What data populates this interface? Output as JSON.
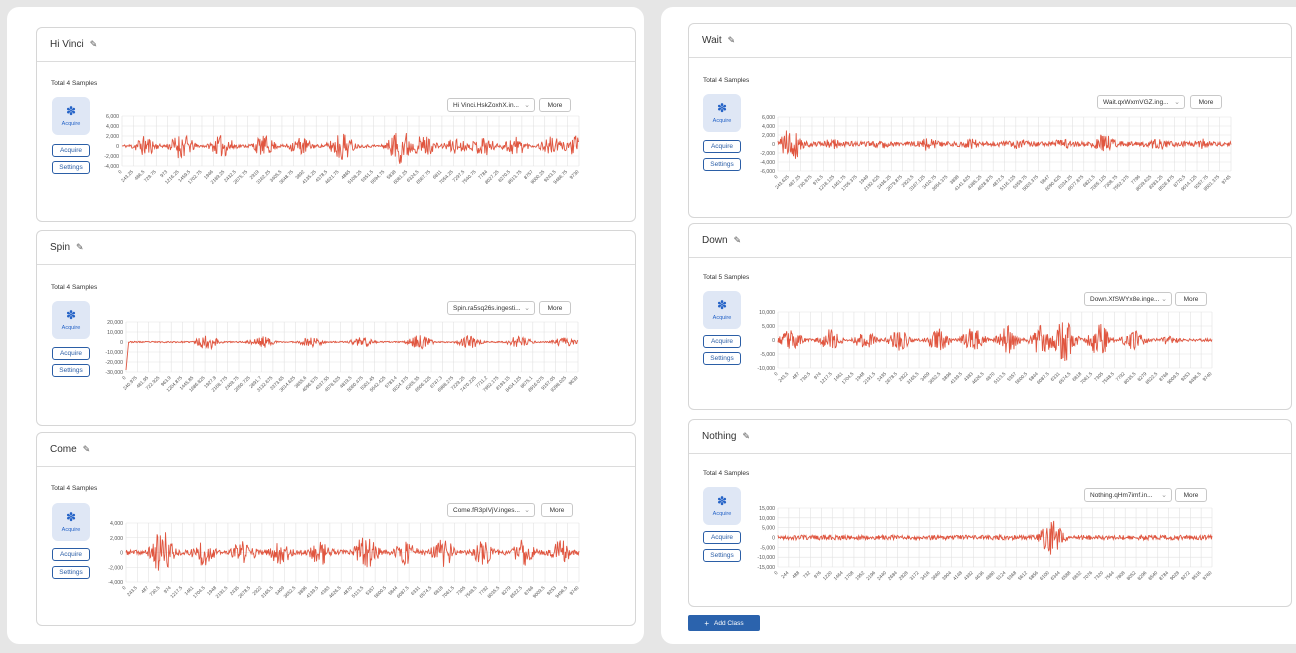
{
  "colors": {
    "waveform": "#e0553f",
    "accent": "#2b63ad",
    "tile_bg": "#dfe7f5"
  },
  "icons": {
    "edit": "pencil-icon",
    "acquire": "lightbulb-icon",
    "chevron": "chevron-down-icon",
    "add": "plus-icon"
  },
  "add_class_label": "Add Class",
  "cards": [
    {
      "title": "Hi Vinci",
      "total": "Total 4 Samples",
      "tile_label": "Acquire",
      "acquire_label": "Acquire",
      "settings_label": "Settings",
      "select_value": "Hi Vinci.HskZoxhX.in...",
      "more_label": "More",
      "chart_data": {
        "type": "line",
        "y_ticks": [
          "6,000",
          "4,000",
          "2,000",
          "0",
          "-2,000",
          "-4,000"
        ],
        "ylim": [
          -4000,
          6000
        ],
        "x_ticks": [
          "0",
          "243.25",
          "486.5",
          "729.75",
          "973",
          "1216.25",
          "1459.5",
          "1702.75",
          "1946",
          "2189.25",
          "2432.5",
          "2675.75",
          "2919",
          "3162.25",
          "3405.5",
          "3648.75",
          "3892",
          "4135.25",
          "4378.5",
          "4621.75",
          "4865",
          "5108.25",
          "5351.5",
          "5594.75",
          "5838",
          "6081.25",
          "6324.5",
          "6567.75",
          "6811",
          "7054.25",
          "7297.5",
          "7540.75",
          "7784",
          "8027.25",
          "8270.5",
          "8513.75",
          "8757",
          "9000.25",
          "9243.5",
          "9486.75",
          "9730"
        ],
        "bursts": [
          [
            0.05,
            0.55
          ],
          [
            0.13,
            0.7
          ],
          [
            0.22,
            0.6
          ],
          [
            0.31,
            0.55
          ],
          [
            0.39,
            0.5
          ],
          [
            0.48,
            0.8
          ],
          [
            0.61,
            1.0
          ],
          [
            0.66,
            0.6
          ],
          [
            0.73,
            0.45
          ],
          [
            0.79,
            0.55
          ],
          [
            0.86,
            0.55
          ],
          [
            0.94,
            0.5
          ],
          [
            0.99,
            0.55
          ]
        ],
        "noise": 0.08,
        "amp": 3800,
        "seed": 11
      }
    },
    {
      "title": "Spin",
      "total": "Total 4 Samples",
      "tile_label": "Acquire",
      "acquire_label": "Acquire",
      "settings_label": "Settings",
      "select_value": "Spin.ra5sq26s.ingesti...",
      "more_label": "More",
      "chart_data": {
        "type": "line",
        "y_ticks": [
          "20,000",
          "10,000",
          "0",
          "-10,000",
          "-20,000",
          "-30,000"
        ],
        "ylim": [
          -30000,
          20000
        ],
        "x_ticks": [
          "0",
          "240.975",
          "481.95",
          "722.925",
          "963.9",
          "1204.875",
          "1445.85",
          "1686.825",
          "1927.8",
          "2168.775",
          "2409.75",
          "2650.725",
          "2891.7",
          "3132.675",
          "3373.65",
          "3614.625",
          "3855.6",
          "4096.575",
          "4337.55",
          "4578.525",
          "4819.5",
          "5060.475",
          "5301.45",
          "5542.425",
          "5783.4",
          "6024.375",
          "6265.35",
          "6506.325",
          "6747.3",
          "6988.275",
          "7229.25",
          "7470.225",
          "7711.2",
          "7952.175",
          "8193.15",
          "8434.125",
          "8675.1",
          "8916.075",
          "9157.05",
          "9398.025",
          "9639"
        ],
        "bursts": [
          [
            0.18,
            0.55
          ],
          [
            0.3,
            0.45
          ],
          [
            0.41,
            0.4
          ],
          [
            0.52,
            0.45
          ],
          [
            0.65,
            0.5
          ],
          [
            0.76,
            0.45
          ],
          [
            0.87,
            0.45
          ],
          [
            0.97,
            0.35
          ]
        ],
        "spike_start": -28000,
        "noise": 0.05,
        "amp": 14000,
        "seed": 23
      }
    },
    {
      "title": "Come",
      "total": "Total 4 Samples",
      "tile_label": "Acquire",
      "acquire_label": "Acquire",
      "settings_label": "Settings",
      "select_value": "Come.fR3pIVjV.inges...",
      "more_label": "More",
      "chart_data": {
        "type": "line",
        "y_ticks": [
          "4,000",
          "2,000",
          "0",
          "-2,000",
          "-4,000"
        ],
        "ylim": [
          -4000,
          4000
        ],
        "x_ticks": [
          "0",
          "243.5",
          "487",
          "730.5",
          "974",
          "1217.5",
          "1461",
          "1704.5",
          "1948",
          "2191.5",
          "2435",
          "2678.5",
          "2922",
          "3165.5",
          "3409",
          "3652.5",
          "3896",
          "4139.5",
          "4383",
          "4626.5",
          "4870",
          "5113.5",
          "5357",
          "5600.5",
          "5844",
          "6087.5",
          "6331",
          "6574.5",
          "6818",
          "7061.5",
          "7305",
          "7548.5",
          "7792",
          "8035.5",
          "8279",
          "8522.5",
          "8766",
          "9009.5",
          "9253",
          "9496.5",
          "9740"
        ],
        "bursts": [
          [
            0.08,
            0.9
          ],
          [
            0.17,
            0.55
          ],
          [
            0.26,
            0.5
          ],
          [
            0.34,
            0.5
          ],
          [
            0.43,
            0.5
          ],
          [
            0.53,
            0.75
          ],
          [
            0.62,
            0.5
          ],
          [
            0.7,
            0.6
          ],
          [
            0.79,
            0.5
          ],
          [
            0.88,
            0.55
          ],
          [
            0.96,
            0.5
          ]
        ],
        "noise": 0.1,
        "amp": 3400,
        "seed": 37
      }
    },
    {
      "title": "Wait",
      "total": "Total 4 Samples",
      "tile_label": "Acquire",
      "acquire_label": "Acquire",
      "settings_label": "Settings",
      "select_value": "Wait.qxWxmVGZ.ing...",
      "more_label": "More",
      "chart_data": {
        "type": "line",
        "y_ticks": [
          "6,000",
          "4,000",
          "2,000",
          "0",
          "-2,000",
          "-4,000",
          "-6,000"
        ],
        "ylim": [
          -6000,
          6000
        ],
        "x_ticks": [
          "0",
          "243.625",
          "487.25",
          "730.875",
          "974.5",
          "1218.125",
          "1461.75",
          "1705.375",
          "1949",
          "2192.625",
          "2436.25",
          "2679.875",
          "2923.5",
          "3167.125",
          "3410.75",
          "3654.375",
          "3898",
          "4141.625",
          "4385.25",
          "4628.875",
          "4872.5",
          "5116.125",
          "5359.75",
          "5603.375",
          "5847",
          "6090.625",
          "6334.25",
          "6577.875",
          "6821.5",
          "7065.125",
          "7308.75",
          "7552.375",
          "7796",
          "8039.625",
          "8283.25",
          "8526.875",
          "8770.5",
          "9014.125",
          "9257.75",
          "9501.375",
          "9745"
        ],
        "bursts": [
          [
            0.03,
            0.8
          ],
          [
            0.12,
            0.25
          ],
          [
            0.23,
            0.2
          ],
          [
            0.33,
            0.3
          ],
          [
            0.43,
            0.25
          ],
          [
            0.53,
            0.25
          ],
          [
            0.63,
            0.3
          ],
          [
            0.72,
            0.45
          ],
          [
            0.84,
            0.3
          ],
          [
            0.94,
            0.25
          ]
        ],
        "noise": 0.12,
        "amp": 5000,
        "seed": 41
      }
    },
    {
      "title": "Down",
      "total": "Total 5 Samples",
      "tile_label": "Acquire",
      "acquire_label": "Acquire",
      "settings_label": "Settings",
      "select_value": "Down.XfSWYx8e.inge...",
      "more_label": "More",
      "chart_data": {
        "type": "line",
        "y_ticks": [
          "10,000",
          "5,000",
          "0",
          "-5,000",
          "-10,000"
        ],
        "ylim": [
          -10000,
          10000
        ],
        "x_ticks": [
          "0",
          "243.5",
          "487",
          "730.5",
          "974",
          "1217.5",
          "1461",
          "1704.5",
          "1948",
          "2191.5",
          "2435",
          "2678.5",
          "2922",
          "3165.5",
          "3409",
          "3652.5",
          "3896",
          "4139.5",
          "4383",
          "4626.5",
          "4870",
          "5113.5",
          "5357",
          "5600.5",
          "5844",
          "6087.5",
          "6331",
          "6574.5",
          "6818",
          "7061.5",
          "7305",
          "7548.5",
          "7792",
          "8035.5",
          "8279",
          "8522.5",
          "8766",
          "9009.5",
          "9253",
          "9496.5",
          "9740"
        ],
        "bursts": [
          [
            0.03,
            0.45
          ],
          [
            0.12,
            0.45
          ],
          [
            0.2,
            0.4
          ],
          [
            0.28,
            0.45
          ],
          [
            0.37,
            0.5
          ],
          [
            0.45,
            0.55
          ],
          [
            0.53,
            0.6
          ],
          [
            0.61,
            0.75
          ],
          [
            0.66,
            0.9
          ],
          [
            0.74,
            0.7
          ],
          [
            0.82,
            0.45
          ],
          [
            0.9,
            0.2
          ]
        ],
        "noise": 0.06,
        "amp": 8500,
        "seed": 53
      }
    },
    {
      "title": "Nothing",
      "total": "Total 4 Samples",
      "tile_label": "Acquire",
      "acquire_label": "Acquire",
      "settings_label": "Settings",
      "select_value": "Nothing.qHm7imf.in...",
      "more_label": "More",
      "chart_data": {
        "type": "line",
        "y_ticks": [
          "15,000",
          "10,000",
          "5,000",
          "0",
          "-5,000",
          "-10,000",
          "-15,000"
        ],
        "ylim": [
          -15000,
          15000
        ],
        "x_ticks": [
          "0",
          "244",
          "488",
          "732",
          "976",
          "1220",
          "1464",
          "1708",
          "1952",
          "2196",
          "2440",
          "2684",
          "2928",
          "3172",
          "3416",
          "3660",
          "3904",
          "4148",
          "4392",
          "4636",
          "4880",
          "5124",
          "5368",
          "5612",
          "5856",
          "6100",
          "6344",
          "6588",
          "6832",
          "7076",
          "7320",
          "7564",
          "7808",
          "8052",
          "8296",
          "8540",
          "8784",
          "9028",
          "9272",
          "9516",
          "9760"
        ],
        "bursts": [
          [
            0.63,
            0.75
          ]
        ],
        "noise": 0.1,
        "amp": 12000,
        "seed": 67
      }
    }
  ]
}
